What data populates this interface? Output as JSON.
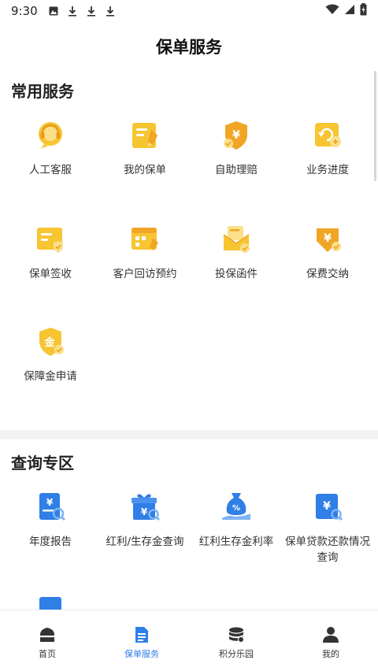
{
  "status_bar": {
    "time": "9:30"
  },
  "header": {
    "title": "保单服务"
  },
  "sections": {
    "common": {
      "title": "常用服务",
      "items": [
        {
          "label": "人工客服",
          "icon": "customer-service-icon"
        },
        {
          "label": "我的保单",
          "icon": "policy-document-icon"
        },
        {
          "label": "自助理赔",
          "icon": "claim-shield-icon"
        },
        {
          "label": "业务进度",
          "icon": "progress-refresh-icon"
        },
        {
          "label": "保单签收",
          "icon": "policy-sign-icon"
        },
        {
          "label": "客户回访预约",
          "icon": "visit-appointment-icon"
        },
        {
          "label": "投保函件",
          "icon": "insurance-letter-icon"
        },
        {
          "label": "保费交纳",
          "icon": "premium-payment-icon"
        },
        {
          "label": "保障金申请",
          "icon": "benefit-gold-icon"
        }
      ]
    },
    "query": {
      "title": "查询专区",
      "items": [
        {
          "label": "年度报告",
          "icon": "annual-report-icon"
        },
        {
          "label": "红利/生存金查询",
          "icon": "dividend-gift-icon"
        },
        {
          "label": "红利生存金利率",
          "icon": "interest-rate-bag-icon"
        },
        {
          "label": "保单贷款还款情况查询",
          "icon": "loan-repayment-icon"
        }
      ]
    }
  },
  "bottom_nav": {
    "items": [
      {
        "label": "首页",
        "icon": "home-icon",
        "active": false
      },
      {
        "label": "保单服务",
        "icon": "policy-service-icon",
        "active": true
      },
      {
        "label": "积分乐园",
        "icon": "points-coins-icon",
        "active": false
      },
      {
        "label": "我的",
        "icon": "profile-icon",
        "active": false
      }
    ]
  },
  "colors": {
    "accent": "#2f7fe6",
    "icon_yellow": "#f7c531",
    "icon_orange": "#f0a525",
    "icon_blue": "#2f7fe6"
  }
}
